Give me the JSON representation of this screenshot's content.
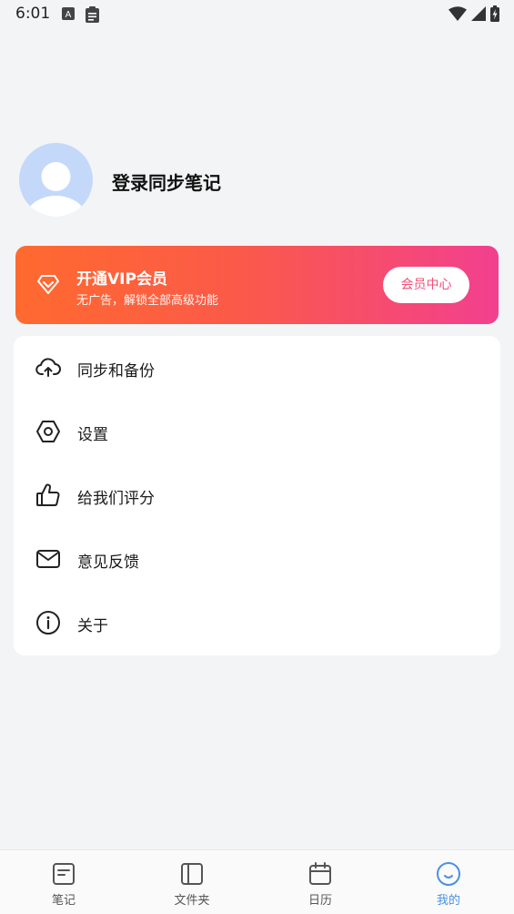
{
  "status_bar": {
    "time": "6:01"
  },
  "profile": {
    "login_text": "登录同步笔记"
  },
  "vip": {
    "title": "开通VIP会员",
    "subtitle": "无广告，解锁全部高级功能",
    "button_label": "会员中心",
    "gradient_start": "#ff6a2f",
    "gradient_end": "#f2408f"
  },
  "menu": {
    "items": [
      {
        "label": "同步和备份",
        "icon": "cloud-upload-icon"
      },
      {
        "label": "设置",
        "icon": "hexagon-settings-icon"
      },
      {
        "label": "给我们评分",
        "icon": "thumbs-up-icon"
      },
      {
        "label": "意见反馈",
        "icon": "mail-icon"
      },
      {
        "label": "关于",
        "icon": "info-icon"
      }
    ]
  },
  "bottom_nav": {
    "active_color": "#4a90e2",
    "items": [
      {
        "label": "笔记",
        "icon": "note-icon"
      },
      {
        "label": "文件夹",
        "icon": "folder-icon"
      },
      {
        "label": "日历",
        "icon": "calendar-icon"
      },
      {
        "label": "我的",
        "icon": "smile-icon",
        "active": true
      }
    ]
  }
}
